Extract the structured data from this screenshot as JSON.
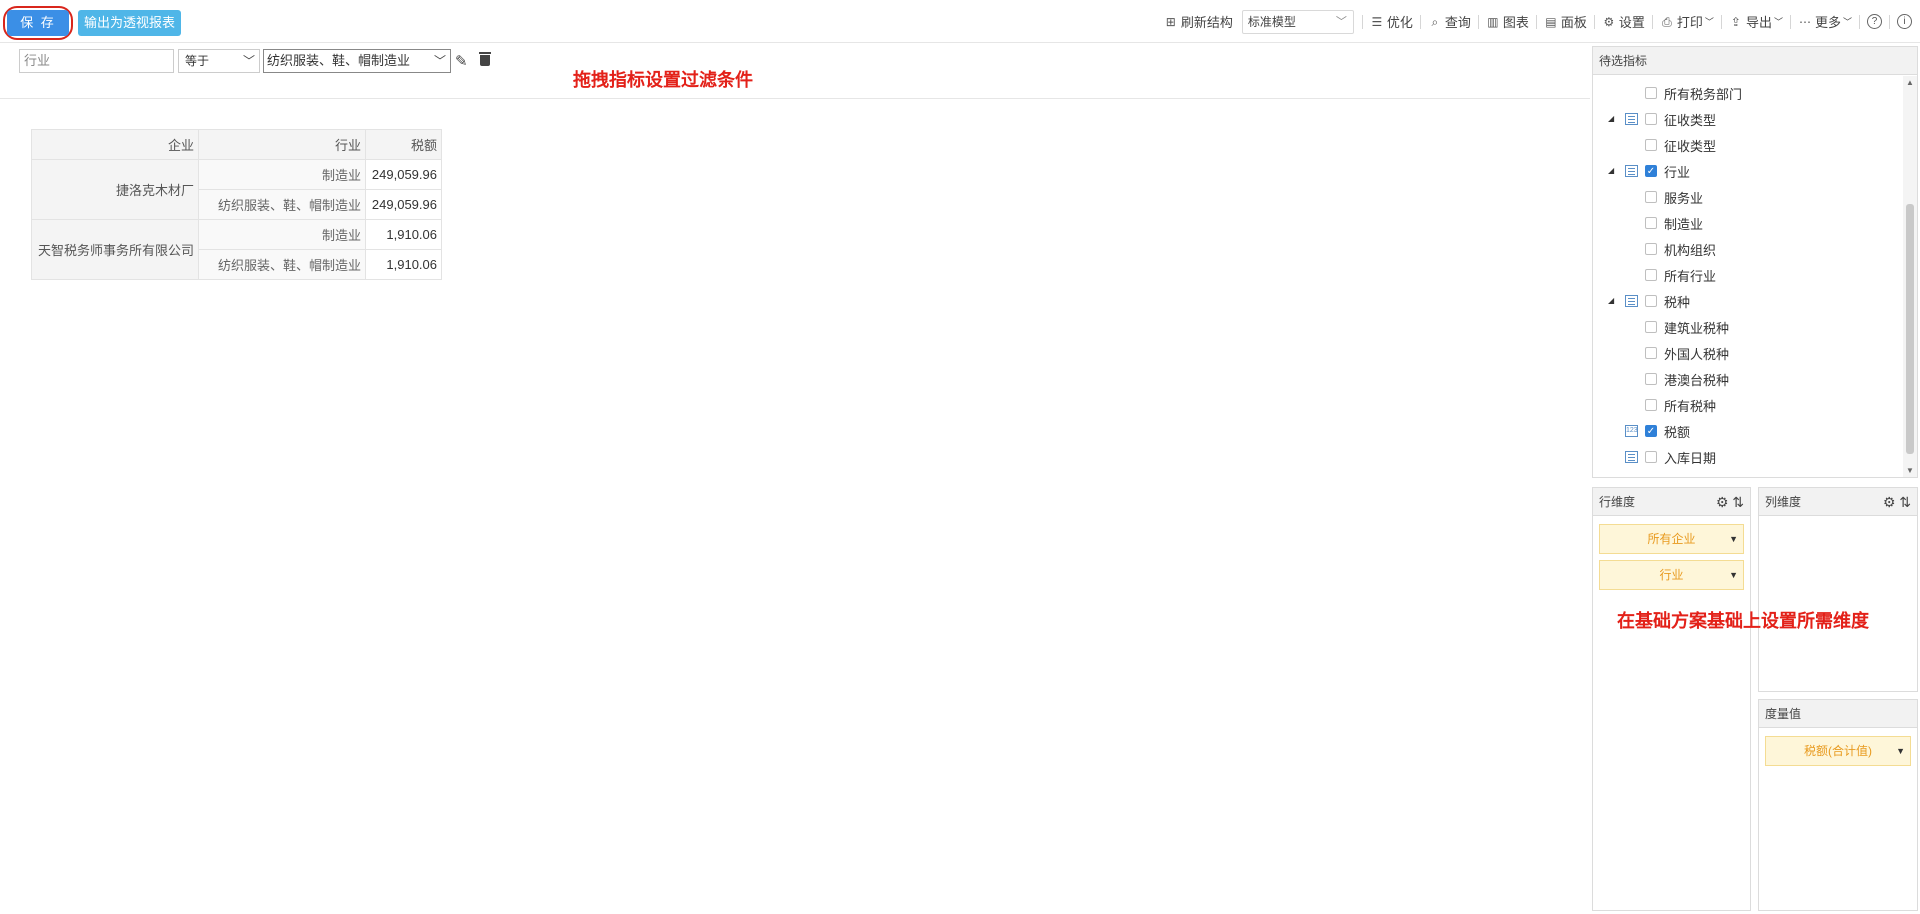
{
  "toolbar": {
    "save_label": "保 存",
    "export_pivot_label": "输出为透视报表",
    "refresh_label": "刷新结构",
    "model_value": "标准模型",
    "optimize_label": "优化",
    "query_label": "查询",
    "chart_label": "图表",
    "panel_label": "面板",
    "settings_label": "设置",
    "print_label": "打印",
    "export_label": "导出",
    "more_label": "更多"
  },
  "filter": {
    "field_placeholder": "行业",
    "operator": "等于",
    "value": "纺织服装、鞋、帽制造业",
    "hint": "拖拽指标设置过滤条件"
  },
  "pivot": {
    "headers": [
      "企业",
      "行业",
      "税额"
    ],
    "groups": [
      {
        "enterprise": "捷洛克木材厂",
        "rows": [
          {
            "industry": "制造业",
            "tax": "249,059.96"
          },
          {
            "industry": "纺织服装、鞋、帽制造业",
            "tax": "249,059.96"
          }
        ]
      },
      {
        "enterprise": "天智税务师事务所有限公司",
        "rows": [
          {
            "industry": "制造业",
            "tax": "1,910.06"
          },
          {
            "industry": "纺织服装、鞋、帽制造业",
            "tax": "1,910.06"
          }
        ]
      }
    ]
  },
  "candidates": {
    "title": "待选指标",
    "items": [
      {
        "label": "所有税务部门",
        "level": 1,
        "kind": "leaf",
        "checked": false
      },
      {
        "label": "征收类型",
        "level": 0,
        "kind": "dim",
        "checked": false
      },
      {
        "label": "征收类型",
        "level": 1,
        "kind": "leaf",
        "checked": false
      },
      {
        "label": "行业",
        "level": 0,
        "kind": "dim",
        "checked": true
      },
      {
        "label": "服务业",
        "level": 1,
        "kind": "leaf",
        "checked": false
      },
      {
        "label": "制造业",
        "level": 1,
        "kind": "leaf",
        "checked": false
      },
      {
        "label": "机构组织",
        "level": 1,
        "kind": "leaf",
        "checked": false
      },
      {
        "label": "所有行业",
        "level": 1,
        "kind": "leaf",
        "checked": false
      },
      {
        "label": "税种",
        "level": 0,
        "kind": "dim",
        "checked": false
      },
      {
        "label": "建筑业税种",
        "level": 1,
        "kind": "leaf",
        "checked": false
      },
      {
        "label": "外国人税种",
        "level": 1,
        "kind": "leaf",
        "checked": false
      },
      {
        "label": "港澳台税种",
        "level": 1,
        "kind": "leaf",
        "checked": false
      },
      {
        "label": "所有税种",
        "level": 1,
        "kind": "leaf",
        "checked": false
      },
      {
        "label": "税额",
        "level": 0,
        "kind": "measure",
        "checked": true
      },
      {
        "label": "入库日期",
        "level": 0,
        "kind": "dim-noexpand",
        "checked": false
      }
    ]
  },
  "row_dim": {
    "title": "行维度",
    "pills": [
      "所有企业",
      "行业"
    ]
  },
  "col_dim": {
    "title": "列维度"
  },
  "measure": {
    "title": "度量值",
    "pills": [
      "税额(合计值)"
    ]
  },
  "dim_hint": "在基础方案基础上设置所需维度"
}
